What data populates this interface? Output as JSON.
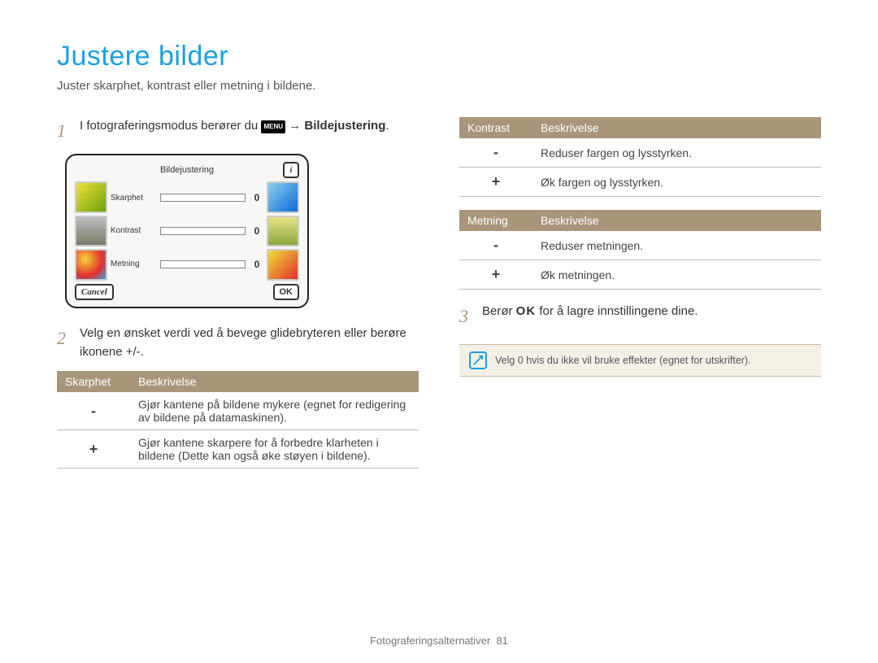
{
  "page": {
    "title": "Justere bilder",
    "subtitle": "Juster skarphet, kontrast eller metning i bildene.",
    "footer_section": "Fotograferingsalternativer",
    "footer_page": "81"
  },
  "steps": {
    "s1_num": "1",
    "s1_pre": "I fotograferingsmodus berører du ",
    "s1_menu": "MENU",
    "s1_arrow": " → ",
    "s1_bold": "Bildejustering",
    "s1_post": ".",
    "s2_num": "2",
    "s2_text": "Velg en ønsket verdi ved å bevege glidebryteren eller berøre ikonene +/-.",
    "s3_num": "3",
    "s3_pre": "Berør ",
    "s3_ok": "OK",
    "s3_post": " for å lagre innstillingene dine."
  },
  "screenshot": {
    "title": "Bildejustering",
    "sliders": [
      {
        "label": "Skarphet",
        "value": "0"
      },
      {
        "label": "Kontrast",
        "value": "0"
      },
      {
        "label": "Metning",
        "value": "0"
      }
    ],
    "cancel": "Cancel",
    "ok": "OK"
  },
  "tables": {
    "skarphet": {
      "h1": "Skarphet",
      "h2": "Beskrivelse",
      "r1s": "-",
      "r1d": "Gjør kantene på bildene mykere (egnet for redigering av bildene på datamaskinen).",
      "r2s": "+",
      "r2d": "Gjør kantene skarpere for å forbedre klarheten i bildene (Dette kan også øke støyen i bildene)."
    },
    "kontrast": {
      "h1": "Kontrast",
      "h2": "Beskrivelse",
      "r1s": "-",
      "r1d": "Reduser fargen og lysstyrken.",
      "r2s": "+",
      "r2d": "Øk fargen og lysstyrken."
    },
    "metning": {
      "h1": "Metning",
      "h2": "Beskrivelse",
      "r1s": "-",
      "r1d": "Reduser metningen.",
      "r2s": "+",
      "r2d": "Øk metningen."
    }
  },
  "note": {
    "text": "Velg 0 hvis du ikke vil bruke effekter (egnet for utskrifter)."
  }
}
